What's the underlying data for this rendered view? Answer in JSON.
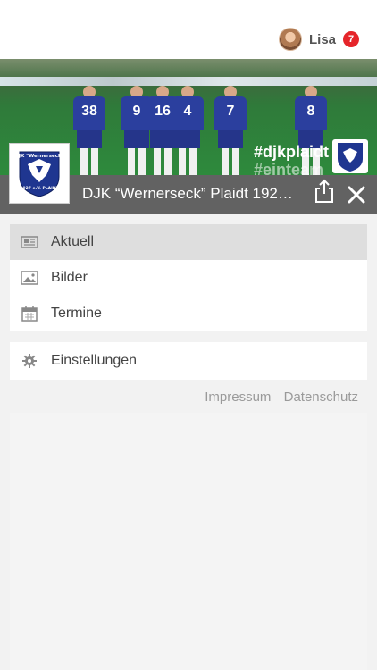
{
  "user": {
    "name": "Lisa",
    "notifications": "7"
  },
  "hero": {
    "hashtag_primary": "#djkplaidt",
    "hashtag_secondary": "#einteam",
    "player_numbers": [
      "38",
      "9",
      "16",
      "4",
      "7",
      "8"
    ]
  },
  "club": {
    "name": "DJK “Wernerseck” Plaidt 192…",
    "logo_text_top": "DJK \"Wernerseck\"",
    "logo_text_bottom": "1927 e.V.  PLAIDT"
  },
  "menu": {
    "items": [
      {
        "label": "Aktuell",
        "icon": "newspaper-icon",
        "active": true
      },
      {
        "label": "Bilder",
        "icon": "image-icon",
        "active": false
      },
      {
        "label": "Termine",
        "icon": "calendar-icon",
        "active": false
      }
    ],
    "settings_label": "Einstellungen"
  },
  "footer": {
    "impressum": "Impressum",
    "datenschutz": "Datenschutz"
  },
  "colors": {
    "accent_badge": "#e5252a",
    "club_bar": "#5a5a5a",
    "active_row": "#dedede"
  }
}
